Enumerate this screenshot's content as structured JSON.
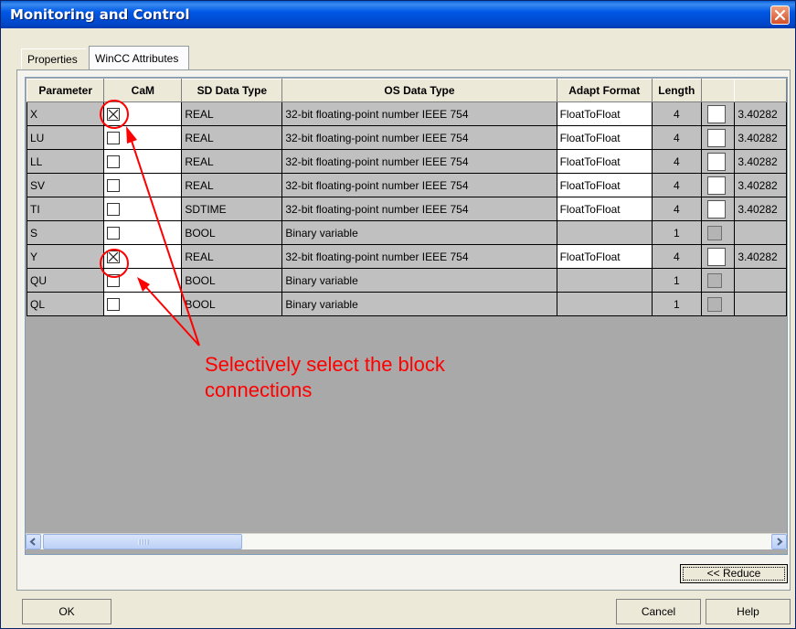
{
  "window": {
    "title": "Monitoring and Control"
  },
  "tabs": [
    {
      "label": "Properties",
      "active": false
    },
    {
      "label": "WinCC Attributes",
      "active": true
    }
  ],
  "table": {
    "columns": [
      "Parameter",
      "CaM",
      "SD Data Type",
      "OS Data Type",
      "Adapt Format",
      "Length",
      "",
      ""
    ],
    "rows": [
      {
        "parameter": "X",
        "cam": true,
        "sd_type": "REAL",
        "os_type": "32-bit floating-point number IEEE 754",
        "adapt": "FloatToFloat",
        "length": "4",
        "checkbox_enabled": true,
        "limit": "3.40282"
      },
      {
        "parameter": "LU",
        "cam": false,
        "sd_type": "REAL",
        "os_type": "32-bit floating-point number IEEE 754",
        "adapt": "FloatToFloat",
        "length": "4",
        "checkbox_enabled": true,
        "limit": "3.40282"
      },
      {
        "parameter": "LL",
        "cam": false,
        "sd_type": "REAL",
        "os_type": "32-bit floating-point number IEEE 754",
        "adapt": "FloatToFloat",
        "length": "4",
        "checkbox_enabled": true,
        "limit": "3.40282"
      },
      {
        "parameter": "SV",
        "cam": false,
        "sd_type": "REAL",
        "os_type": "32-bit floating-point number IEEE 754",
        "adapt": "FloatToFloat",
        "length": "4",
        "checkbox_enabled": true,
        "limit": "3.40282"
      },
      {
        "parameter": "TI",
        "cam": false,
        "sd_type": "SDTIME",
        "os_type": "32-bit floating-point number IEEE 754",
        "adapt": "FloatToFloat",
        "length": "4",
        "checkbox_enabled": true,
        "limit": "3.40282"
      },
      {
        "parameter": "S",
        "cam": false,
        "sd_type": "BOOL",
        "os_type": "Binary variable",
        "adapt": "",
        "length": "1",
        "checkbox_enabled": false,
        "limit": ""
      },
      {
        "parameter": "Y",
        "cam": true,
        "sd_type": "REAL",
        "os_type": "32-bit floating-point number IEEE 754",
        "adapt": "FloatToFloat",
        "length": "4",
        "checkbox_enabled": true,
        "limit": "3.40282"
      },
      {
        "parameter": "QU",
        "cam": false,
        "sd_type": "BOOL",
        "os_type": "Binary variable",
        "adapt": "",
        "length": "1",
        "checkbox_enabled": false,
        "limit": ""
      },
      {
        "parameter": "QL",
        "cam": false,
        "sd_type": "BOOL",
        "os_type": "Binary variable",
        "adapt": "",
        "length": "1",
        "checkbox_enabled": false,
        "limit": ""
      }
    ]
  },
  "buttons": {
    "reduce": "<< Reduce",
    "ok": "OK",
    "cancel": "Cancel",
    "help": "Help"
  },
  "annotation": {
    "line1": "Selectively select the block",
    "line2": "connections",
    "color": "#ff0000"
  },
  "icons": {
    "close": "close-icon",
    "scroll_left": "arrow-left-icon",
    "scroll_right": "arrow-right-icon",
    "scroll_grip": "grip-icon"
  }
}
